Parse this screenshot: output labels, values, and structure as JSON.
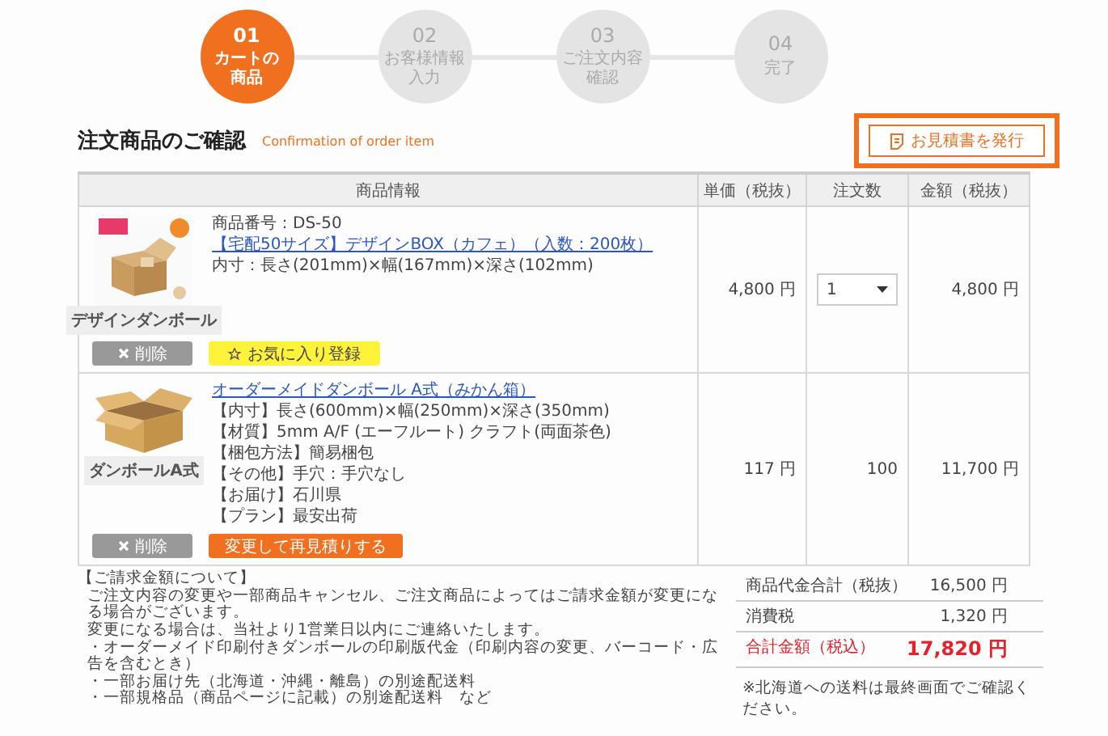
{
  "steps": [
    {
      "number": "01",
      "label_lines": [
        "カートの",
        "商品"
      ],
      "selected": true
    },
    {
      "number": "02",
      "label_lines": [
        "お客様情報",
        "入力"
      ],
      "selected": false
    },
    {
      "number": "03",
      "label_lines": [
        "ご注文内容",
        "確認"
      ],
      "selected": false
    },
    {
      "number": "04",
      "label_lines": [
        "完了"
      ],
      "selected": false
    }
  ],
  "heading": {
    "title": "注文商品のご確認",
    "subtitle": "Confirmation of order item"
  },
  "quote_button": {
    "label": "お見積書を発行"
  },
  "table": {
    "columns": [
      "商品情報",
      "単価（税抜）",
      "注文数",
      "金額（税抜）"
    ],
    "rows": [
      {
        "image_label": "デザインダンボール",
        "lines": [
          {
            "kind": "text",
            "text": "商品番号：DS-50"
          },
          {
            "kind": "link",
            "text": "【宅配50サイズ】デザインBOX（カフェ）（入数：200枚）"
          },
          {
            "kind": "text",
            "text": "内寸：長さ(201mm)×幅(167mm)×深さ(102mm)"
          }
        ],
        "buttons": [
          {
            "kind": "delete",
            "label": "削除"
          },
          {
            "kind": "favorite",
            "label": "お気に入り登録"
          }
        ],
        "unit_price": "4,800 円",
        "quantity": {
          "kind": "select",
          "value": "1"
        },
        "amount": "4,800 円"
      },
      {
        "image_label": "ダンボールA式",
        "lines": [
          {
            "kind": "link",
            "text": "オーダーメイドダンボール A式（みかん箱）"
          },
          {
            "kind": "text",
            "text": "【内寸】長さ(600mm)×幅(250mm)×深さ(350mm)"
          },
          {
            "kind": "text",
            "text": "【材質】5mm A/F (エーフルート) クラフト(両面茶色)"
          },
          {
            "kind": "text",
            "text": "【梱包方法】簡易梱包"
          },
          {
            "kind": "text",
            "text": "【その他】手穴：手穴なし"
          },
          {
            "kind": "text",
            "text": "【お届け】石川県"
          },
          {
            "kind": "text",
            "text": "【プラン】最安出荷"
          }
        ],
        "buttons": [
          {
            "kind": "delete",
            "label": "削除"
          },
          {
            "kind": "reorder",
            "label": "変更して再見積りする"
          }
        ],
        "unit_price": "117 円",
        "quantity": {
          "kind": "text",
          "value": "100"
        },
        "amount": "11,700 円"
      }
    ]
  },
  "notes": {
    "title": "【ご請求金額について】",
    "paragraphs": [
      "ご注文内容の変更や一部商品キャンセル、ご注文商品によってはご請求金額が変更になる場合がございます。",
      "変更になる場合は、当社より1営業日以内にご連絡いたします。"
    ],
    "bullets": [
      "・オーダーメイド印刷付きダンボールの印刷版代金（印刷内容の変更、バーコード・広告を含むとき）",
      "・一部お届け先（北海道・沖縄・離島）の別途配送料",
      "・一部規格品（商品ページに記載）の別途配送料　など"
    ]
  },
  "totals": {
    "rows": [
      {
        "kind": "subtotal",
        "label": "商品代金合計（税抜）",
        "value": "16,500 円"
      },
      {
        "kind": "subtotal",
        "label": "消費税",
        "value": "1,320 円"
      },
      {
        "kind": "total",
        "label": "合計金額（税込）",
        "value": "17,820 円"
      }
    ],
    "note": "※北海道への送料は最終画面でご確認ください。"
  }
}
